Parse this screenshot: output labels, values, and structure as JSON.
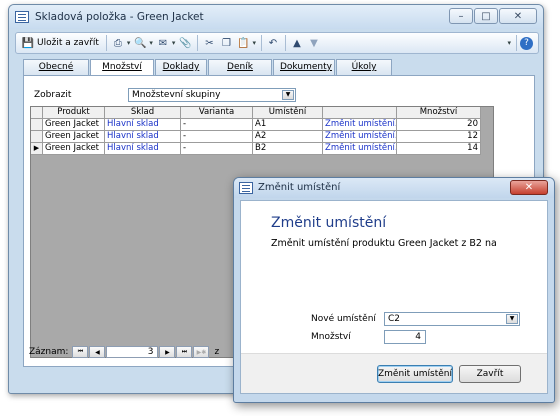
{
  "main_window": {
    "title": "Skladová položka - Green Jacket",
    "toolbar": {
      "save_close_label": "Uložit a zavřít"
    },
    "tabs": [
      "Obecné",
      "Množství",
      "Doklady",
      "Deník událostí",
      "Dokumenty",
      "Úkoly"
    ],
    "active_tab": "Množství",
    "filter": {
      "label": "Zobrazit",
      "value": "Množstevní skupiny"
    },
    "grid": {
      "headers": [
        "Produkt",
        "Sklad",
        "Varianta",
        "Umístění",
        "",
        "Množství"
      ],
      "rows": [
        {
          "produkt": "Green Jacket",
          "sklad": "Hlavní sklad",
          "varianta": "-",
          "umisteni": "A1",
          "zmenit": "Změnit umístění...",
          "mnozstvi": "20"
        },
        {
          "produkt": "Green Jacket",
          "sklad": "Hlavní sklad",
          "varianta": "-",
          "umisteni": "A2",
          "zmenit": "Změnit umístění...",
          "mnozstvi": "12"
        },
        {
          "produkt": "Green Jacket",
          "sklad": "Hlavní sklad",
          "varianta": "-",
          "umisteni": "B2",
          "zmenit": "Změnit umístění...",
          "mnozstvi": "14"
        }
      ]
    },
    "navigator": {
      "label": "Záznam:",
      "current": "3",
      "of": "z"
    }
  },
  "dialog": {
    "title": "Změnit umístění",
    "heading": "Změnit umístění",
    "subtitle": "Změnit umístění produktu Green Jacket z B2 na",
    "new_location_label": "Nové umístění",
    "new_location_value": "C2",
    "quantity_label": "Množství",
    "quantity_value": "4",
    "ok_label": "Změnit umístění",
    "cancel_label": "Zavřít"
  }
}
